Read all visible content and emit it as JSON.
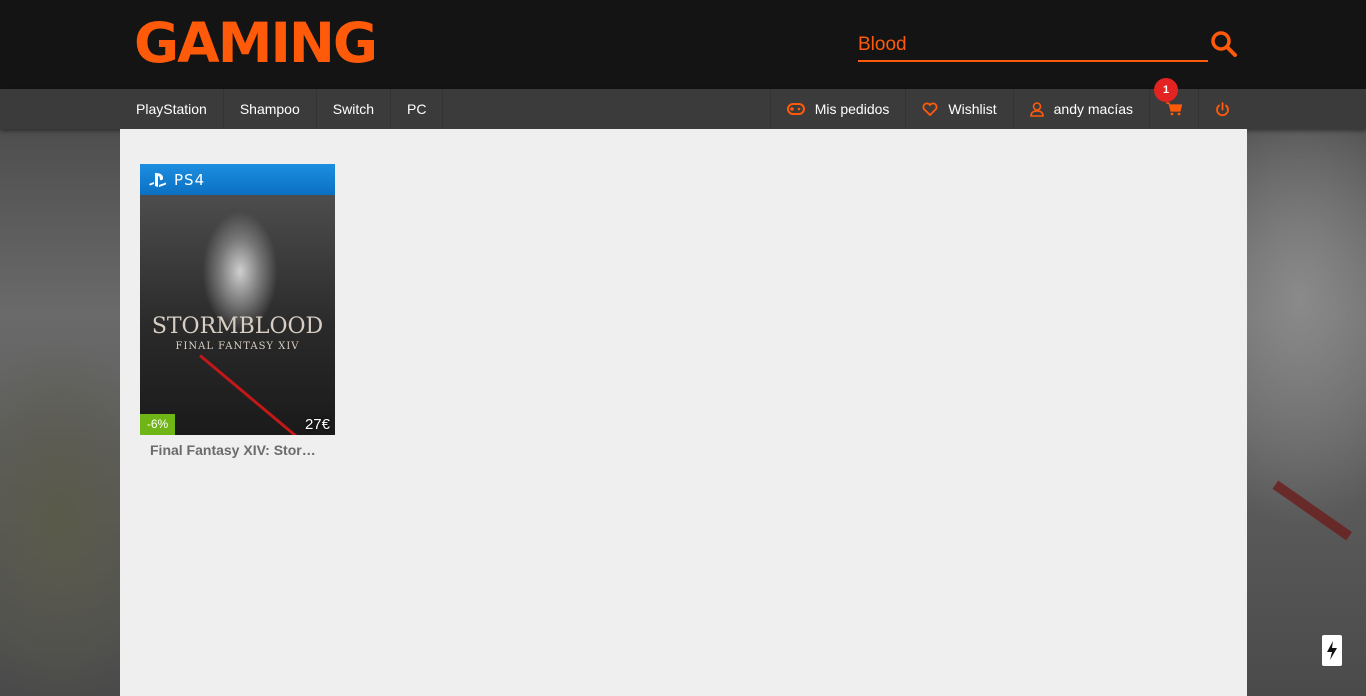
{
  "header": {
    "logo": "GAMING",
    "search": {
      "value": "Blood",
      "placeholder": ""
    }
  },
  "nav": {
    "left": [
      {
        "label": "PlayStation"
      },
      {
        "label": "Shampoo"
      },
      {
        "label": "Switch"
      },
      {
        "label": "PC"
      }
    ],
    "right": {
      "orders_label": "Mis pedidos",
      "wishlist_label": "Wishlist",
      "user_label": "andy macías",
      "cart_count": "1"
    }
  },
  "results": [
    {
      "title": "Final Fantasy XIV: Stor…",
      "platform": "PS4",
      "cover_title": "STORMBLOOD",
      "cover_subtitle": "FINAL FANTASY XIV",
      "discount": "-6%",
      "price": "27€"
    }
  ],
  "colors": {
    "accent": "#ff5a0a",
    "header_bg": "#151414",
    "nav_bg": "#3b3b3b",
    "panel_bg": "#efefef",
    "discount_bg": "#6fb515",
    "badge": "#e32222"
  }
}
